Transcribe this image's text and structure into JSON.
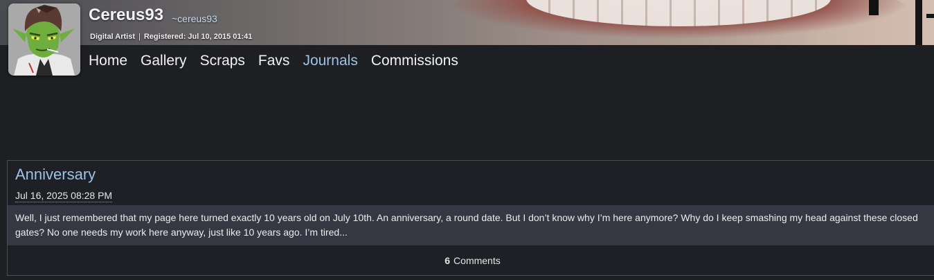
{
  "profile": {
    "display_name": "Cereus93",
    "handle": "~cereus93",
    "role": "Digital Artist",
    "separator": "|",
    "registered": "Registered: Jul 10, 2015 01:41",
    "avatar_icon": "goblin-avatar"
  },
  "nav": {
    "items": [
      {
        "label": "Home"
      },
      {
        "label": "Gallery"
      },
      {
        "label": "Scraps"
      },
      {
        "label": "Favs"
      },
      {
        "label": "Journals",
        "active": true
      },
      {
        "label": "Commissions"
      }
    ],
    "active_color": "#9dc3e6"
  },
  "journal": {
    "title": "Anniversary",
    "date": "Jul 16, 2025 08:28 PM",
    "body": "Well, I just remembered that my page here turned exactly 10 years old on July 10th. An anniversary, a round date. But I don’t know why I’m here anymore? Why do I keep smashing my head against these closed gates? No one needs my work here anyway, just like 10 years ago. I’m tired...",
    "comments_count": "6",
    "comments_label": "Comments"
  },
  "colors": {
    "background": "#1e1f23",
    "card_body": "#353842",
    "link": "#9dc3e6"
  }
}
